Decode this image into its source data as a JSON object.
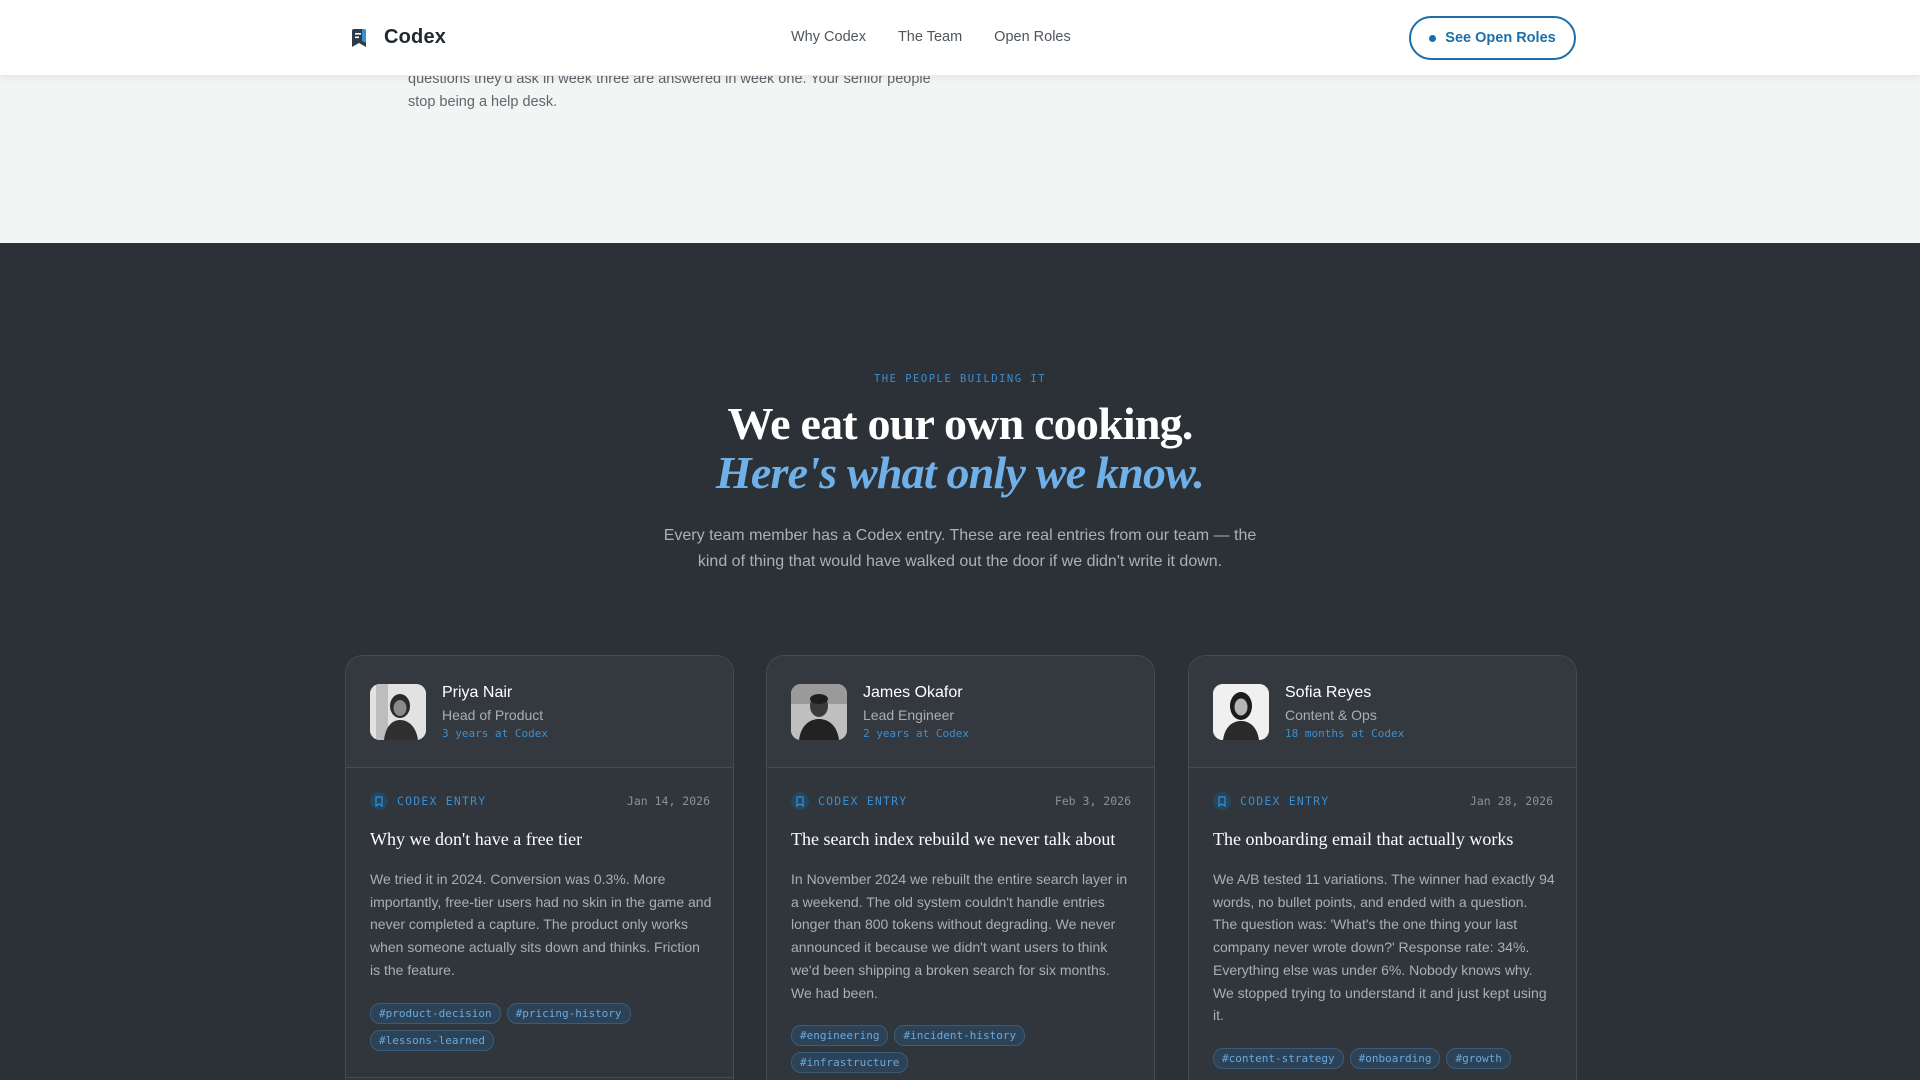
{
  "header": {
    "logo_text": "Codex",
    "logo_icon": "bookmark-logo-icon",
    "nav": [
      "Why Codex",
      "The Team",
      "Open Roles"
    ],
    "cta_label": "See Open Roles"
  },
  "previous_section": {
    "text": "questions they'd ask in week three are answered in week one. Your senior people stop being a help desk."
  },
  "team_section": {
    "eyebrow": "THE PEOPLE BUILDING IT",
    "headline_line1": "We eat our own cooking.",
    "headline_line2": "Here's what only we know.",
    "intro": "Every team member has a Codex entry. These are real entries from our team — the kind of thing that would have walked out the door if we didn't write it down."
  },
  "cards": [
    {
      "name": "Priya Nair",
      "role": "Head of Product",
      "tenure": "3 years at Codex",
      "entry_label": "CODEX ENTRY",
      "date": "Jan 14, 2026",
      "title": "Why we don't have a free tier",
      "body": "We tried it in 2024. Conversion was 0.3%. More importantly, free-tier users had no skin in the game and never completed a capture. The product only works when someone actually sits down and thinks. Friction is the feature.",
      "tags": [
        "#product-decision",
        "#pricing-history",
        "#lessons-learned"
      ]
    },
    {
      "name": "James Okafor",
      "role": "Lead Engineer",
      "tenure": "2 years at Codex",
      "entry_label": "CODEX ENTRY",
      "date": "Feb 3, 2026",
      "title": "The search index rebuild we never talk about",
      "body": "In November 2024 we rebuilt the entire search layer in a weekend. The old system couldn't handle entries longer than 800 tokens without degrading. We never announced it because we didn't want users to think we'd been shipping a broken search for six months. We had been.",
      "tags": [
        "#engineering",
        "#incident-history",
        "#infrastructure"
      ]
    },
    {
      "name": "Sofia Reyes",
      "role": "Content & Ops",
      "tenure": "18 months at Codex",
      "entry_label": "CODEX ENTRY",
      "date": "Jan 28, 2026",
      "title": "The onboarding email that actually works",
      "body": "We A/B tested 11 variations. The winner had exactly 94 words, no bullet points, and ended with a question. The question was: 'What's the one thing your last company never wrote down?' Response rate: 34%. Everything else was under 6%. Nobody knows why. We stopped trying to understand it and just kept using it.",
      "tags": [
        "#content-strategy",
        "#onboarding",
        "#growth"
      ]
    }
  ]
}
